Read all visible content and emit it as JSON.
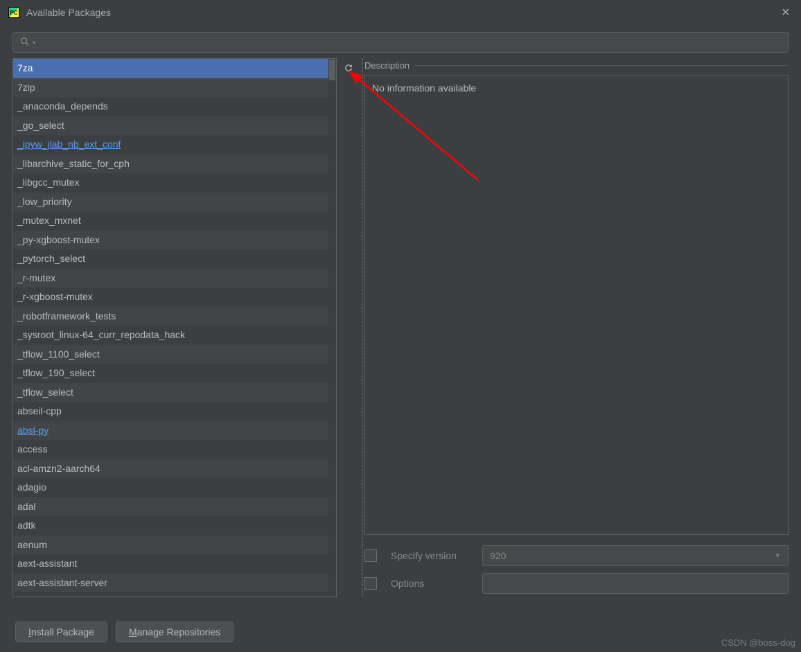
{
  "window": {
    "title": "Available Packages",
    "app_icon_text": "PC"
  },
  "search": {
    "placeholder": ""
  },
  "packages": [
    {
      "name": "7za",
      "selected": true
    },
    {
      "name": "7zip"
    },
    {
      "name": "_anaconda_depends"
    },
    {
      "name": "_go_select"
    },
    {
      "name": "_ipyw_jlab_nb_ext_conf",
      "link": true
    },
    {
      "name": "_libarchive_static_for_cph"
    },
    {
      "name": "_libgcc_mutex"
    },
    {
      "name": "_low_priority"
    },
    {
      "name": "_mutex_mxnet"
    },
    {
      "name": "_py-xgboost-mutex"
    },
    {
      "name": "_pytorch_select"
    },
    {
      "name": "_r-mutex"
    },
    {
      "name": "_r-xgboost-mutex"
    },
    {
      "name": "_robotframework_tests"
    },
    {
      "name": "_sysroot_linux-64_curr_repodata_hack"
    },
    {
      "name": "_tflow_1100_select"
    },
    {
      "name": "_tflow_190_select"
    },
    {
      "name": "_tflow_select"
    },
    {
      "name": "abseil-cpp"
    },
    {
      "name": "absl-py",
      "link": true
    },
    {
      "name": "access"
    },
    {
      "name": "acl-amzn2-aarch64"
    },
    {
      "name": "adagio"
    },
    {
      "name": "adal"
    },
    {
      "name": "adtk"
    },
    {
      "name": "aenum"
    },
    {
      "name": "aext-assistant"
    },
    {
      "name": "aext-assistant-server"
    }
  ],
  "description": {
    "label": "Description",
    "text": "No information available"
  },
  "options": {
    "specify_version_label": "Specify version",
    "version_value": "920",
    "options_label": "Options",
    "options_value": ""
  },
  "buttons": {
    "install": "Install Package",
    "manage": "Manage Repositories"
  },
  "watermark": "CSDN @boss-dog"
}
